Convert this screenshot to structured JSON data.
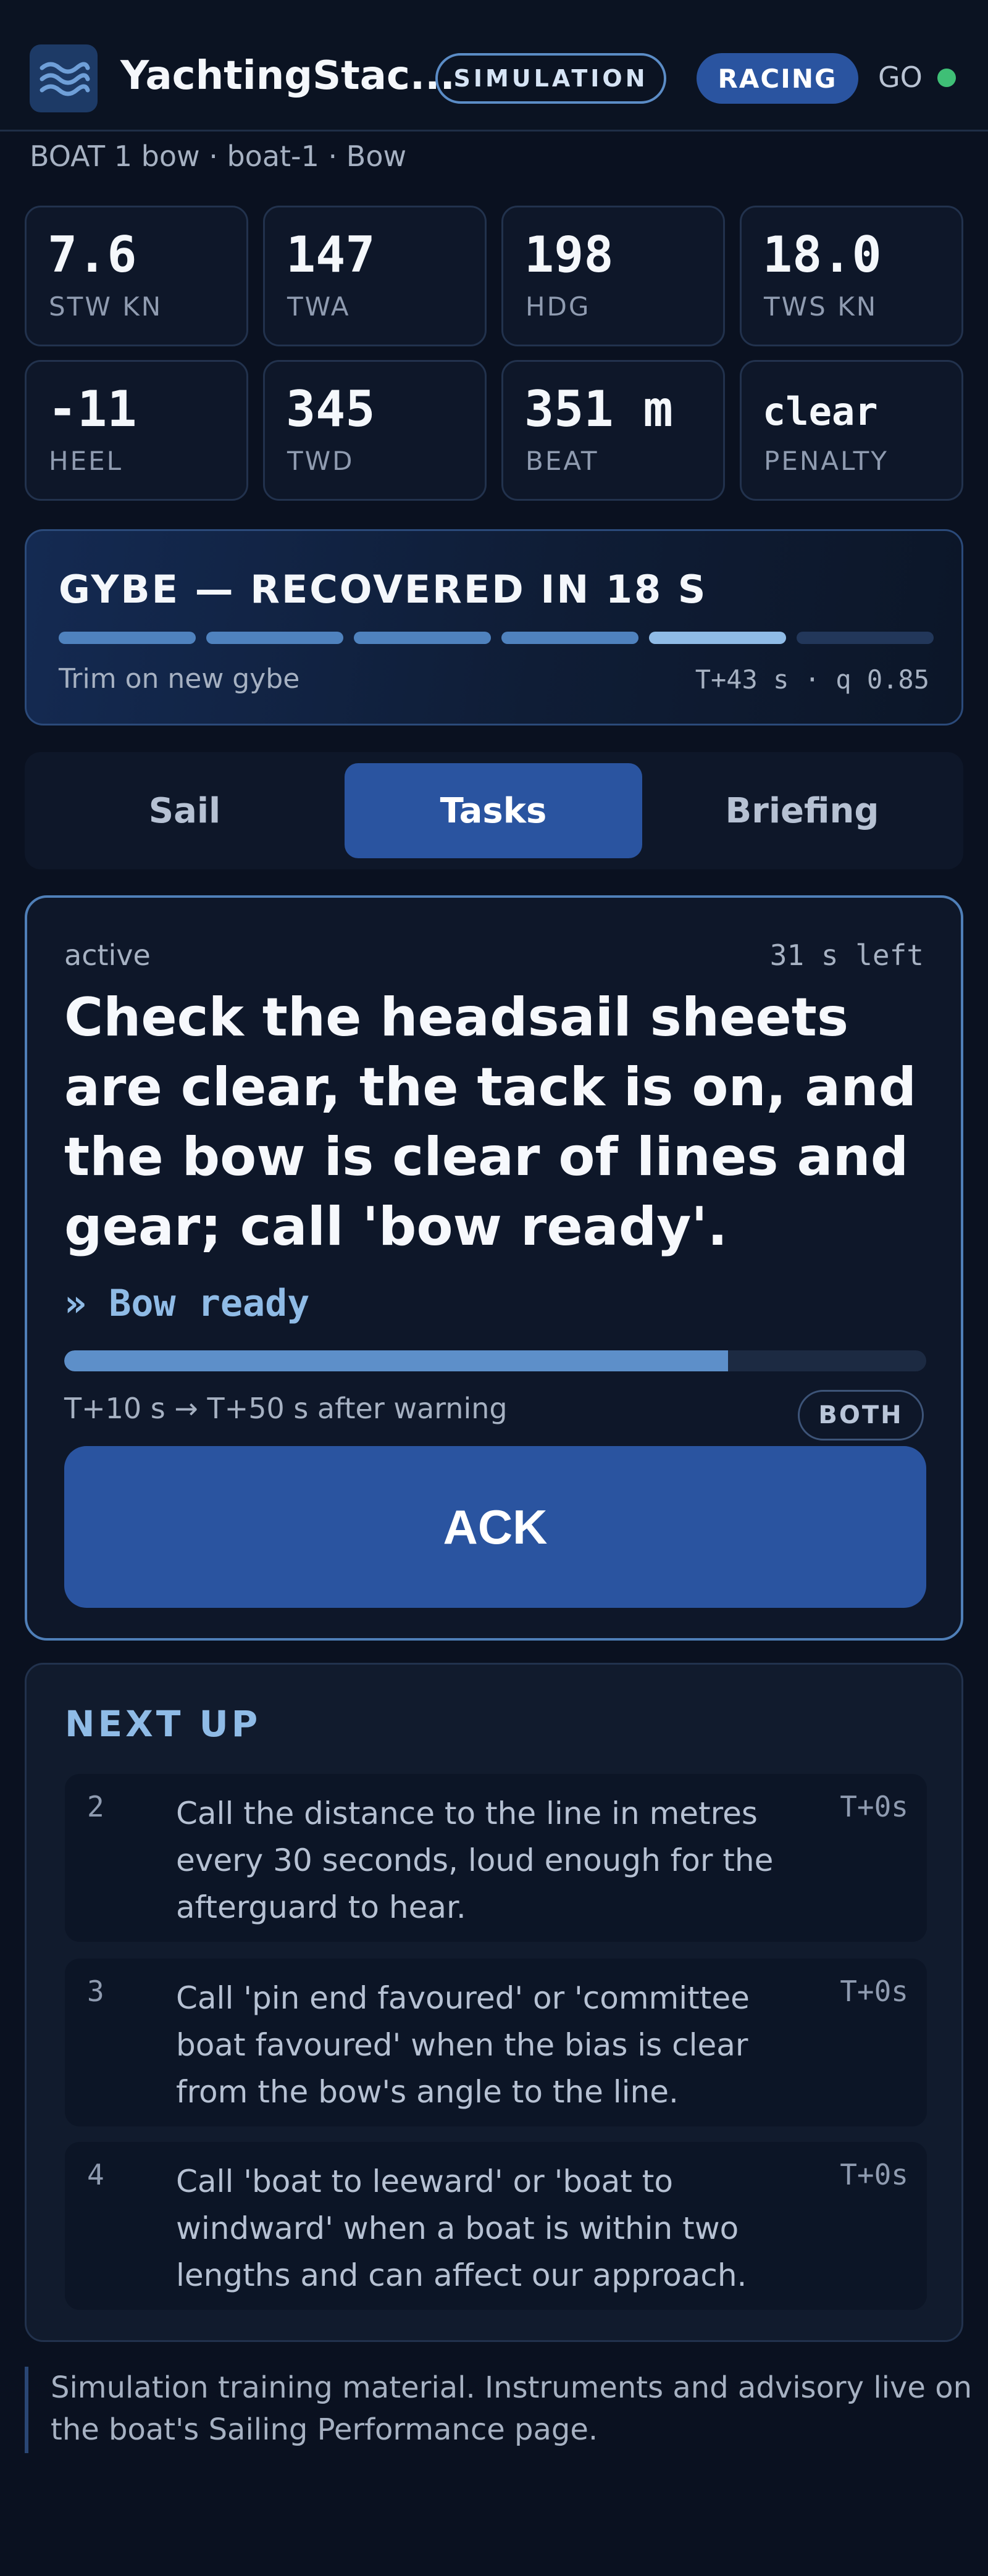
{
  "header": {
    "app_title": "YachtingStac...",
    "mode_badge": "SIMULATION",
    "status_pill": "RACING",
    "go_label": "GO",
    "go_color": "#3fbf76"
  },
  "breadcrumb": "BOAT 1 bow · boat-1 · Bow",
  "stats": [
    {
      "value": "7.6",
      "label": "STW KN"
    },
    {
      "value": "147",
      "label": "TWA"
    },
    {
      "value": "198",
      "label": "HDG"
    },
    {
      "value": "18.0",
      "label": "TWS KN"
    },
    {
      "value": "-11",
      "label": "HEEL"
    },
    {
      "value": "345",
      "label": "TWD"
    },
    {
      "value": "351 m",
      "label": "BEAT"
    },
    {
      "value": "clear",
      "label": "PENALTY"
    }
  ],
  "banner": {
    "title": "GYBE — RECOVERED IN 18 S",
    "subtitle": "Trim on new gybe",
    "meta": "T+43 s · q 0.85",
    "segments_filled": 5,
    "segments_total": 6
  },
  "tabs": [
    {
      "label": "Sail",
      "active": false
    },
    {
      "label": "Tasks",
      "active": true
    },
    {
      "label": "Briefing",
      "active": false
    }
  ],
  "active_task": {
    "status": "active",
    "time_left": "31 s left",
    "text": "Check the headsail sheets are clear, the tack is on, and the bow is clear of lines and gear; call 'bow ready'.",
    "callout": "» Bow ready",
    "progress": 0.77,
    "window": "T+10 s → T+50 s after warning",
    "scope_badge": "BOTH",
    "ack_label": "ACK"
  },
  "next_up": {
    "title": "NEXT UP",
    "items": [
      {
        "num": "2",
        "text": "Call the distance to the line in metres every 30 seconds, loud enough for the afterguard to hear.",
        "time": "T+0s"
      },
      {
        "num": "3",
        "text": "Call 'pin end favoured' or 'committee boat favoured' when the bias is clear from the bow's angle to the line.",
        "time": "T+0s"
      },
      {
        "num": "4",
        "text": "Call 'boat to leeward' or 'boat to windward' when a boat is within two lengths and can affect our approach.",
        "time": "T+0s"
      }
    ]
  },
  "footer_note": "Simulation training material. Instruments and advisory live on the boat's Sailing Performance page.",
  "colors": {
    "accent": "#2a54a0",
    "accent_light": "#8fbbe6",
    "background": "#0a1120"
  }
}
